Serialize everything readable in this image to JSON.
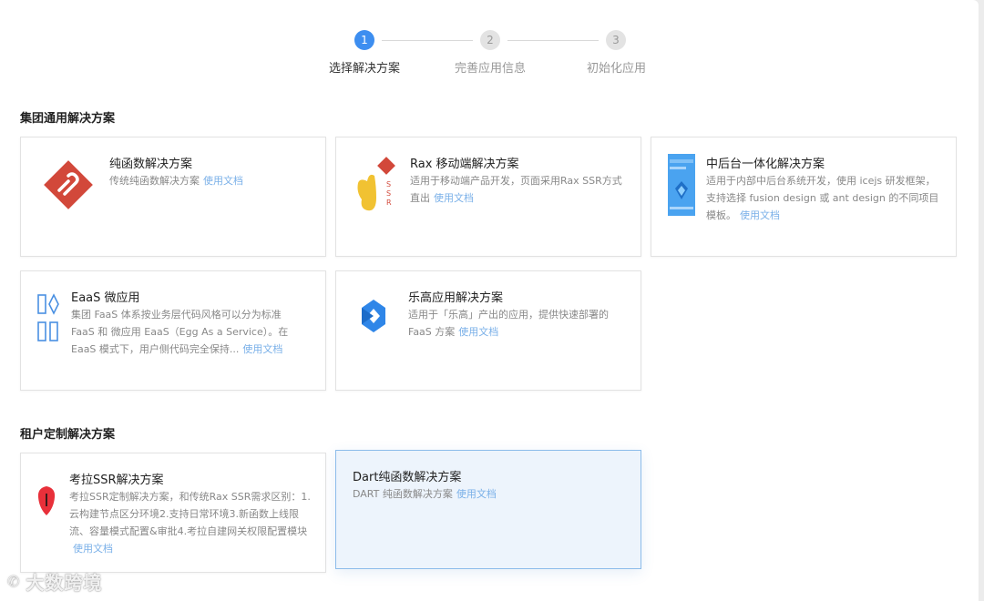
{
  "steps": [
    {
      "num": "1",
      "label": "选择解决方案",
      "active": true
    },
    {
      "num": "2",
      "label": "完善应用信息",
      "active": false
    },
    {
      "num": "3",
      "label": "初始化应用",
      "active": false
    }
  ],
  "sections": {
    "group": {
      "title": "集团通用解决方案"
    },
    "tenant": {
      "title": "租户定制解决方案"
    }
  },
  "doc_link_label": "使用文档",
  "cards": [
    {
      "title": "纯函数解决方案",
      "desc": "传统纯函数解决方案",
      "icon": "lambda-diamond-icon"
    },
    {
      "title": "Rax 移动端解决方案",
      "desc": "适用于移动端产品开发，页面采用Rax SSR方式直出",
      "icon": "rax-rabbit-icon"
    },
    {
      "title": "中后台一体化解决方案",
      "desc": "适用于内部中后台系统开发，使用 icejs 研发框架，支持选择 fusion design 或 ant design 的不同项目模板。",
      "icon": "admin-panel-icon"
    },
    {
      "title": "EaaS 微应用",
      "desc": "集团 FaaS 体系按业务层代码风格可以分为标准 FaaS 和 微应用 EaaS（Egg As a Service）。在 EaaS 模式下，用户侧代码完全保持...",
      "icon": "eaas-blocks-icon"
    },
    {
      "title": "乐高应用解决方案",
      "desc": "适用于「乐高」产出的应用，提供快速部署的 FaaS 方案",
      "icon": "lego-hexagon-icon"
    },
    {
      "title": "考拉SSR解决方案",
      "desc": "考拉SSR定制解决方案，和传统Rax SSR需求区别：1.云构建节点区分环境2.支持日常环境3.新函数上线限流、容量模式配置&审批4.考拉自建网关权限配置模块",
      "icon": "koala-icon"
    },
    {
      "title": "Dart纯函数解决方案",
      "desc": "DART 纯函数解决方案",
      "icon": ""
    }
  ],
  "watermark": "大数跨境",
  "colors": {
    "accent": "#3d8ef0",
    "link": "#7ab0e8",
    "selected_bg": "#edf4fc"
  }
}
